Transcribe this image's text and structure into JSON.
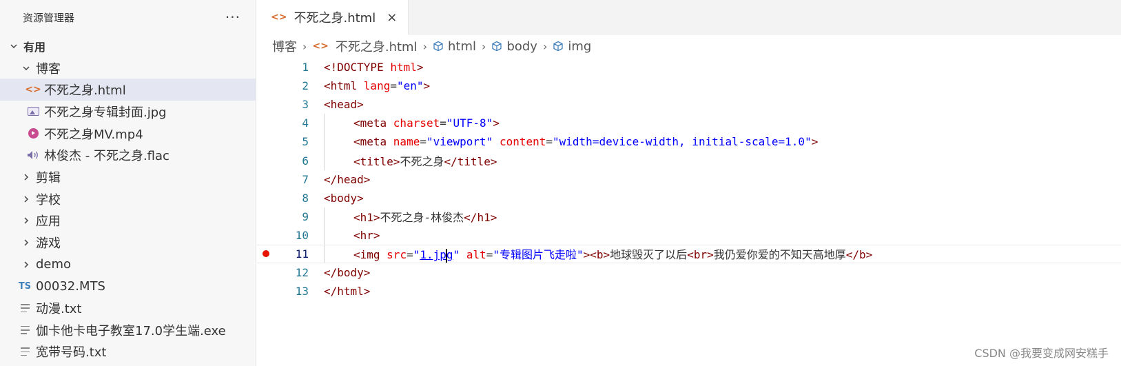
{
  "sidebar": {
    "title": "资源管理器",
    "more": "···",
    "root": "有用",
    "items": [
      {
        "label": "博客",
        "type": "folder-open",
        "level": 1
      },
      {
        "label": "不死之身.html",
        "type": "html",
        "level": 2,
        "selected": true
      },
      {
        "label": "不死之身专辑封面.jpg",
        "type": "image",
        "level": 2
      },
      {
        "label": "不死之身MV.mp4",
        "type": "video",
        "level": 2
      },
      {
        "label": "林俊杰 - 不死之身.flac",
        "type": "audio",
        "level": 2
      },
      {
        "label": "剪辑",
        "type": "folder",
        "level": 1
      },
      {
        "label": "学校",
        "type": "folder",
        "level": 1
      },
      {
        "label": "应用",
        "type": "folder",
        "level": 1
      },
      {
        "label": "游戏",
        "type": "folder",
        "level": 1
      },
      {
        "label": "demo",
        "type": "folder",
        "level": 1
      },
      {
        "label": "00032.MTS",
        "type": "ts",
        "level": 1
      },
      {
        "label": "动漫.txt",
        "type": "text",
        "level": 1
      },
      {
        "label": "伽卡他卡电子教室17.0学生端.exe",
        "type": "text",
        "level": 1
      },
      {
        "label": "宽带号码.txt",
        "type": "text",
        "level": 1
      }
    ]
  },
  "tab": {
    "icon": "<>",
    "label": "不死之身.html",
    "close": "×"
  },
  "breadcrumb": {
    "items": [
      "博客",
      "不死之身.html",
      "html",
      "body",
      "img"
    ],
    "separator": "›"
  },
  "editor": {
    "line_numbers": [
      "1",
      "2",
      "3",
      "4",
      "5",
      "6",
      "7",
      "8",
      "9",
      "10",
      "11",
      "12",
      "13"
    ],
    "current_line": "11"
  },
  "code": {
    "l1": {
      "a": "<!DOCTYPE ",
      "b": "html",
      "c": ">"
    },
    "l2": {
      "a": "<html ",
      "b": "lang",
      "c": "=",
      "d": "\"en\"",
      "e": ">"
    },
    "l3": {
      "a": "<head>"
    },
    "l4": {
      "a": "<meta ",
      "b": "charset",
      "c": "=",
      "d": "\"UTF-8\"",
      "e": ">"
    },
    "l5": {
      "a": "<meta ",
      "b": "name",
      "c": "=",
      "d": "\"viewport\"",
      "e": " ",
      "f": "content",
      "g": "=",
      "h": "\"width=device-width, initial-scale=1.0\"",
      "i": ">"
    },
    "l6": {
      "a": "<title>",
      "b": "不死之身",
      "c": "</title>"
    },
    "l7": {
      "a": "</head>"
    },
    "l8": {
      "a": "<body>"
    },
    "l9": {
      "a": "<h1>",
      "b": "不死之身-林俊杰",
      "c": "</h1>"
    },
    "l10": {
      "a": "<hr>"
    },
    "l11": {
      "a": "<img ",
      "b": "src",
      "c": "=",
      "d": "\"",
      "e": "1.jp",
      "f": "g",
      "g": "\"",
      "h": " ",
      "i": "alt",
      "j": "=",
      "k": "\"专辑图片飞走啦\"",
      "l": "><b>",
      "m": "地球毁灭了以后",
      "n": "<br>",
      "o": "我仍爱你爱的不知天高地厚",
      "p": "</b>"
    },
    "l12": {
      "a": "</body>"
    },
    "l13": {
      "a": "</html>"
    }
  },
  "watermark": "CSDN @我要变成网安糕手",
  "colors": {
    "tag": "#800000",
    "attribute": "#e50000",
    "string": "#0000ff",
    "line_number": "#237893",
    "breakpoint": "#e51400",
    "selection": "#e4e6f1"
  }
}
